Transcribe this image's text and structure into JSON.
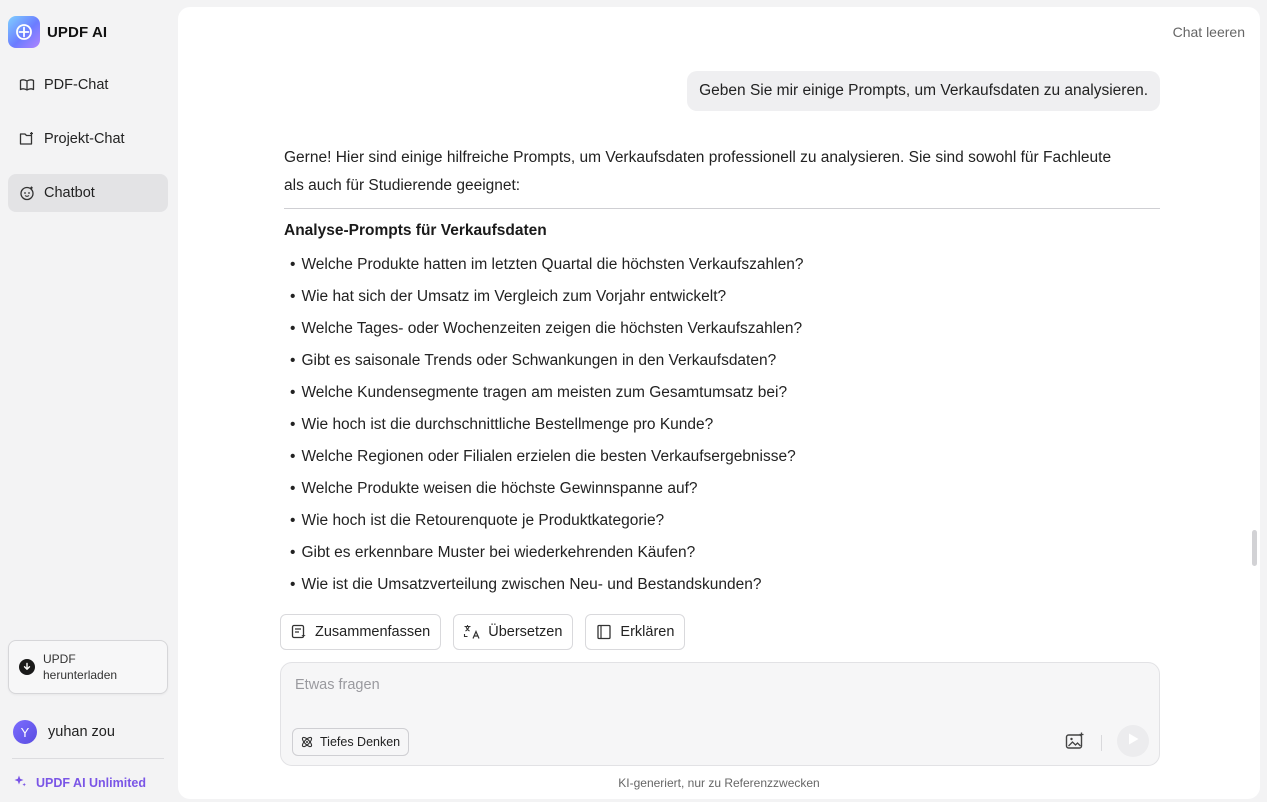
{
  "app": {
    "brand_name": "UPDF AI",
    "logo_icon": "updf-ai-logo-icon",
    "accent": "#7a55e6"
  },
  "sidebar": {
    "items": [
      {
        "label": "PDF-Chat",
        "icon": "book-open-icon",
        "active": false
      },
      {
        "label": "Projekt-Chat",
        "icon": "folder-plus-icon",
        "active": false
      },
      {
        "label": "Chatbot",
        "icon": "bot-face-icon",
        "active": true
      }
    ],
    "download": {
      "line1": "UPDF",
      "line2": "herunterladen",
      "icon": "download-circle-icon"
    },
    "user": {
      "initial": "Y",
      "name": "yuhan zou"
    },
    "unlimited_label": "UPDF AI Unlimited"
  },
  "chat": {
    "clear_label": "Chat leeren",
    "user_message": "Geben Sie mir einige Prompts, um Verkaufsdaten zu analysieren.",
    "assistant": {
      "intro_line1": "Gerne! Hier sind einige hilfreiche Prompts, um Verkaufsdaten professionell zu analysieren. Sie sind sowohl für Fachleute",
      "intro_line2": "als auch für Studierende geeignet:",
      "heading": "Analyse-Prompts für Verkaufsdaten",
      "bullets": [
        "Welche Produkte hatten im letzten Quartal die höchsten Verkaufszahlen?",
        "Wie hat sich der Umsatz im Vergleich zum Vorjahr entwickelt?",
        "Welche Tages- oder Wochenzeiten zeigen die höchsten Verkaufszahlen?",
        "Gibt es saisonale Trends oder Schwankungen in den Verkaufsdaten?",
        "Welche Kundensegmente tragen am meisten zum Gesamtumsatz bei?",
        "Wie hoch ist die durchschnittliche Bestellmenge pro Kunde?",
        "Welche Regionen oder Filialen erzielen die besten Verkaufsergebnisse?",
        "Welche Produkte weisen die höchste Gewinnspanne auf?",
        "Wie hoch ist die Retourenquote je Produktkategorie?",
        "Gibt es erkennbare Muster bei wiederkehrenden Käufen?",
        "Wie ist die Umsatzverteilung zwischen Neu- und Bestandskunden?"
      ]
    },
    "actions": [
      {
        "label": "Zusammenfassen",
        "icon": "summarize-icon"
      },
      {
        "label": "Übersetzen",
        "icon": "translate-icon"
      },
      {
        "label": "Erklären",
        "icon": "book-icon"
      }
    ],
    "input": {
      "placeholder": "Etwas fragen",
      "value": "",
      "deep_think_label": "Tiefes Denken"
    },
    "footer_note": "KI-generiert, nur zu Referenzzwecken"
  }
}
